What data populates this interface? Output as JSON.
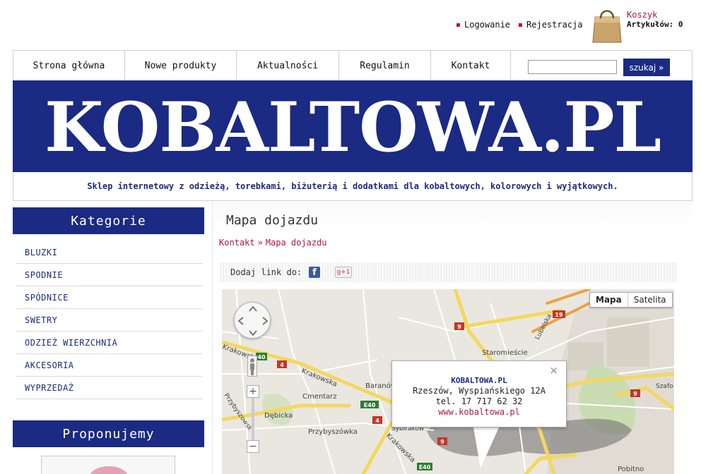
{
  "top": {
    "login_label": "Logowanie",
    "register_label": "Rejestracja",
    "cart_title": "Koszyk",
    "cart_count": "Artykułów: 0",
    "accent": "#b0163a"
  },
  "nav": {
    "items": [
      "Strona główna",
      "Nowe produkty",
      "Aktualności",
      "Regulamin",
      "Kontakt"
    ],
    "search_button": "szukaj »",
    "search_value": ""
  },
  "banner": {
    "logo": "KOBALTOWA.PL",
    "tagline": "Sklep internetowy z odzieżą, torebkami, biżuterią i dodatkami dla kobaltowych, kolorowych i wyjątkowych.",
    "color": "#1b2a82"
  },
  "sidebar": {
    "categories_title": "Kategorie",
    "categories": [
      "BLUZKI",
      "SPODNIE",
      "SPÓDNICE",
      "SWETRY",
      "ODZIEŻ WIERZCHNIA",
      "AKCESORIA",
      "WYPRZEDAŻ"
    ],
    "promo_title": "Proponujemy"
  },
  "main": {
    "title": "Mapa dojazdu",
    "breadcrumb": [
      "Kontakt",
      "»",
      "Mapa dojazdu"
    ],
    "share_label": "Dodaj link do:",
    "facebook_glyph": "f",
    "gplus_glyph": "g+1"
  },
  "map": {
    "type_map": "Mapa",
    "type_satellite": "Satelita",
    "zoom_in": "+",
    "zoom_out": "−",
    "info": {
      "name": "KOBALTOWA.PL",
      "address": "Rzeszów, Wyspiańskiego 12A",
      "phone": "tel. 17 717 62 32",
      "web": "www.kobaltowa.pl",
      "close": "×"
    },
    "labels": {
      "krakowska1": "Krakowska",
      "krakowska2": "Krakowska",
      "krakowska3": "Krakowska",
      "baranowka": "Baranów",
      "cmentarz": "Cmentarz",
      "przybyszowka": "Przybyszówka",
      "debicka": "Dębicka",
      "sybirakow": "Sybiraków",
      "staromiescie": "Staromieście",
      "lubelska": "Lubelska",
      "szafow": "Szafo",
      "pobitno": "Pobitno",
      "przybyszowska": "Przybyszowsk",
      "road_4a": "4",
      "road_4b": "4",
      "road_9a": "9",
      "road_9b": "9",
      "road_19": "19",
      "road_e40a": "40",
      "road_e40b": "E40",
      "road_e40c": "E40",
      "road_e40d": "E40",
      "road_9c": "9"
    }
  }
}
